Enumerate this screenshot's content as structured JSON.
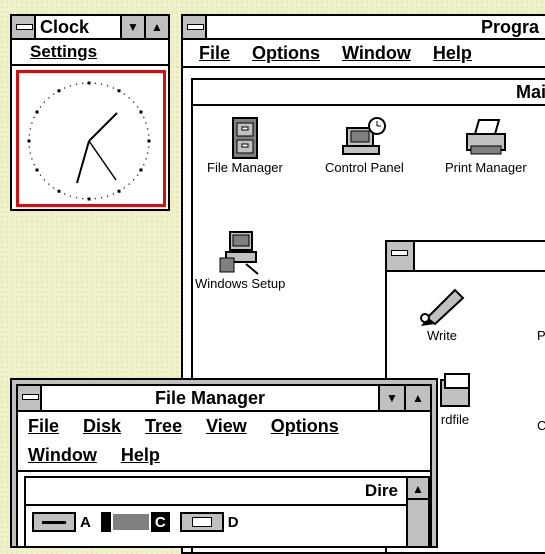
{
  "clock": {
    "title": "Clock",
    "menu": [
      "Settings"
    ]
  },
  "progman": {
    "title": "Progra",
    "menu": [
      "File",
      "Options",
      "Window",
      "Help"
    ],
    "main_group": {
      "title": "Main",
      "icons": [
        "File Manager",
        "Control Panel",
        "Print Manager",
        "Windows Setup"
      ]
    },
    "accessories_group": {
      "icons": [
        "Write",
        "P",
        "rdfile",
        "C"
      ]
    }
  },
  "filemanager": {
    "title": "File Manager",
    "menu_row1": [
      "File",
      "Disk",
      "Tree",
      "View",
      "Options"
    ],
    "menu_row2": [
      "Window",
      "Help"
    ],
    "dir_label": "Dire",
    "drives": [
      "A",
      "C",
      "D"
    ]
  }
}
